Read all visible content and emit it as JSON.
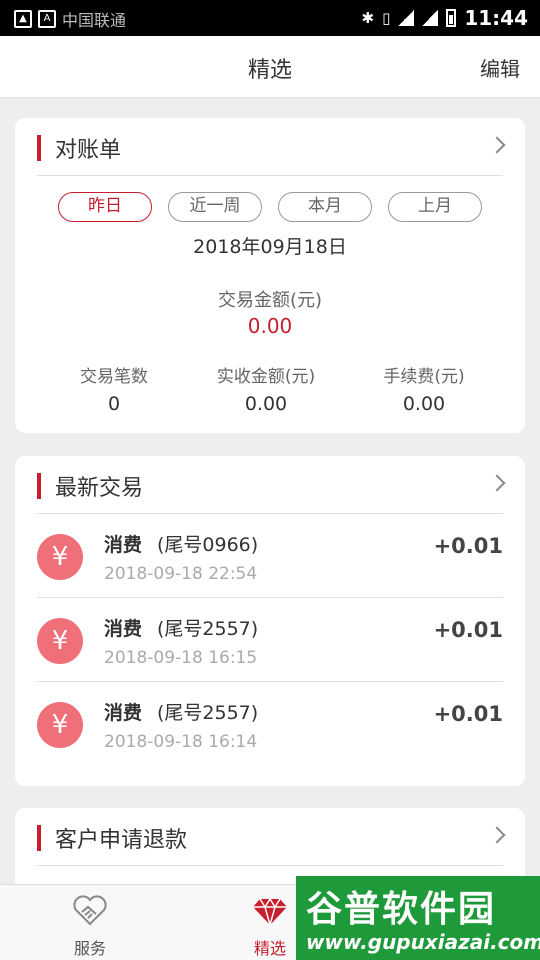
{
  "status_bar": {
    "carrier": "中国联通",
    "time": "11:44"
  },
  "header": {
    "title": "精选",
    "edit_label": "编辑"
  },
  "statement": {
    "title": "对账单",
    "periods": [
      "昨日",
      "近一周",
      "本月",
      "上月"
    ],
    "active_period": "昨日",
    "date": "2018年09月18日",
    "amount_label": "交易金额(元)",
    "amount_value": "0.00",
    "stats": [
      {
        "label": "交易笔数",
        "value": "0"
      },
      {
        "label": "实收金额(元)",
        "value": "0.00"
      },
      {
        "label": "手续费(元)",
        "value": "0.00"
      }
    ]
  },
  "transactions": {
    "title": "最新交易",
    "icon_symbol": "¥",
    "items": [
      {
        "name": "消费",
        "tail": "(尾号0966)",
        "time": "2018-09-18 22:54",
        "amount": "+0.01"
      },
      {
        "name": "消费",
        "tail": "(尾号2557)",
        "time": "2018-09-18 16:15",
        "amount": "+0.01"
      },
      {
        "name": "消费",
        "tail": "(尾号2557)",
        "time": "2018-09-18 16:14",
        "amount": "+0.01"
      }
    ]
  },
  "refund": {
    "title": "客户申请退款"
  },
  "bottom_nav": {
    "items": [
      {
        "label": "服务",
        "icon": "handshake-icon",
        "active": false
      },
      {
        "label": "精选",
        "icon": "diamond-icon",
        "active": true
      }
    ]
  },
  "watermark": {
    "title": "谷普软件园",
    "url": "www.gupuxiazai.com"
  },
  "colors": {
    "accent": "#c61e2c",
    "yen_badge": "#f0707a",
    "watermark": "#1f9a3a"
  }
}
